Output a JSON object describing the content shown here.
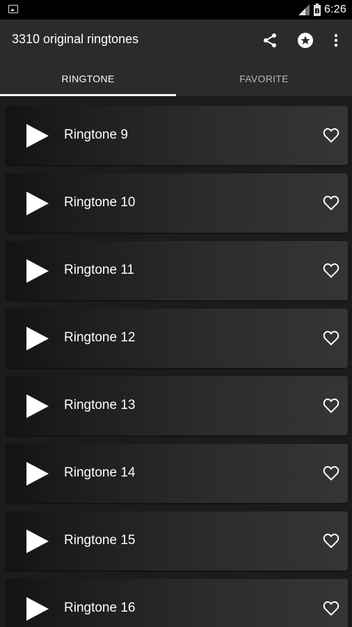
{
  "status_bar": {
    "time": "6:26",
    "battery_label": "B",
    "icons": [
      "image-notification-icon",
      "signal-icon",
      "battery-icon"
    ]
  },
  "app_bar": {
    "title": "3310 original ringtones",
    "actions": [
      "share-icon",
      "rate-star-icon",
      "more-vert-icon"
    ]
  },
  "tabs": [
    {
      "label": "RINGTONE",
      "selected": true
    },
    {
      "label": "FAVORITE",
      "selected": false
    }
  ],
  "ringtones": [
    {
      "label": "Ringtone 9"
    },
    {
      "label": "Ringtone 10"
    },
    {
      "label": "Ringtone 11"
    },
    {
      "label": "Ringtone 12"
    },
    {
      "label": "Ringtone 13"
    },
    {
      "label": "Ringtone 14"
    },
    {
      "label": "Ringtone 15"
    },
    {
      "label": "Ringtone 16"
    }
  ],
  "colors": {
    "app_bar": "#2b2b2b",
    "status_bar": "#000000",
    "list_background": "#1c1c1c",
    "accent": "#ffffff"
  }
}
